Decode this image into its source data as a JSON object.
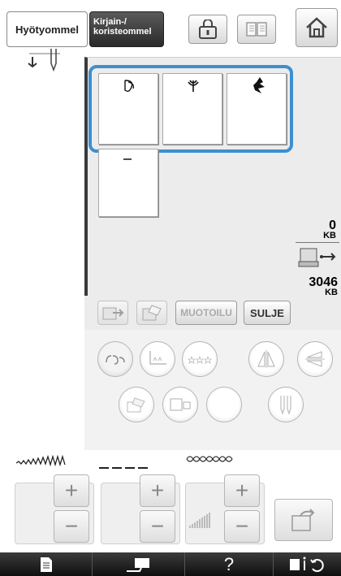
{
  "tabs": {
    "utility": "Hyötyommel",
    "decorative_line1": "Kirjain-/",
    "decorative_line2": "koristeommel"
  },
  "memory": {
    "used_value": "0",
    "used_unit": "KB",
    "free_value": "3046",
    "free_unit": "KB"
  },
  "actions": {
    "format_label": "MUOTOILU",
    "close_label": "SULJE"
  },
  "controls": {
    "help_label": "?"
  },
  "colors": {
    "selection_border": "#3d8fd0",
    "panel_bg": "#ececec",
    "dark_tab": "#3a3a3a"
  },
  "icons": [
    "needle-icon",
    "lock-icon",
    "book-icon",
    "home-icon",
    "usb-icon",
    "pc-icon",
    "delete-icon",
    "copy-icon",
    "page-icon",
    "presser-foot-icon",
    "bobbin-icon"
  ]
}
